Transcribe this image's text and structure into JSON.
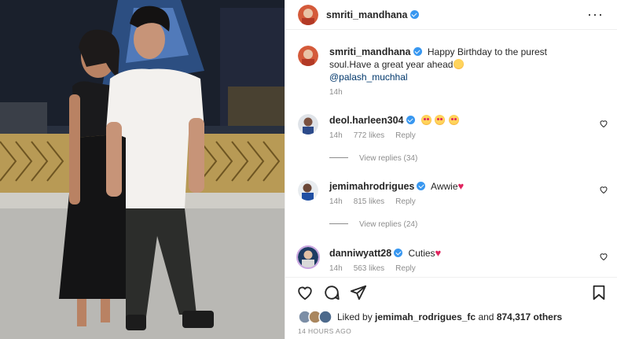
{
  "post": {
    "author": "smriti_mandhana",
    "caption": {
      "username": "smriti_mandhana",
      "text": "Happy Birthday to the purest soul.Have a great year ahead",
      "emoji": "grinning-face-emoji",
      "mention": "@palash_muchhal",
      "age": "14h"
    }
  },
  "comments": [
    {
      "username": "deol.harleen304",
      "text": "",
      "emojis": [
        "heart-eyes-emoji",
        "heart-eyes-emoji",
        "heart-eyes-emoji"
      ],
      "age": "14h",
      "likes": "772 likes",
      "reply": "Reply",
      "view_replies": "View replies (34)"
    },
    {
      "username": "jemimahrodrigues",
      "text": "Awwie",
      "emojis": [
        "red-heart-emoji"
      ],
      "age": "14h",
      "likes": "815 likes",
      "reply": "Reply",
      "view_replies": "View replies (24)"
    },
    {
      "username": "danniwyatt28",
      "text": "Cuties",
      "emojis": [
        "red-heart-emoji"
      ],
      "age": "14h",
      "likes": "563 likes",
      "reply": "Reply"
    }
  ],
  "likes_summary": {
    "prefix": "Liked by",
    "user": "jemimah_rodrigues_fc",
    "mid": "and",
    "count": "874,317 others"
  },
  "timestamp": "14 HOURS AGO",
  "icons": {
    "more": "more-options-icon",
    "like": "heart-icon",
    "comment": "comment-icon",
    "share": "share-icon",
    "save": "bookmark-icon"
  },
  "colors": {
    "verified": "#3897f0",
    "mention": "#00376b",
    "secondary_text": "#8e8e8e",
    "heart": "#e0245e"
  }
}
